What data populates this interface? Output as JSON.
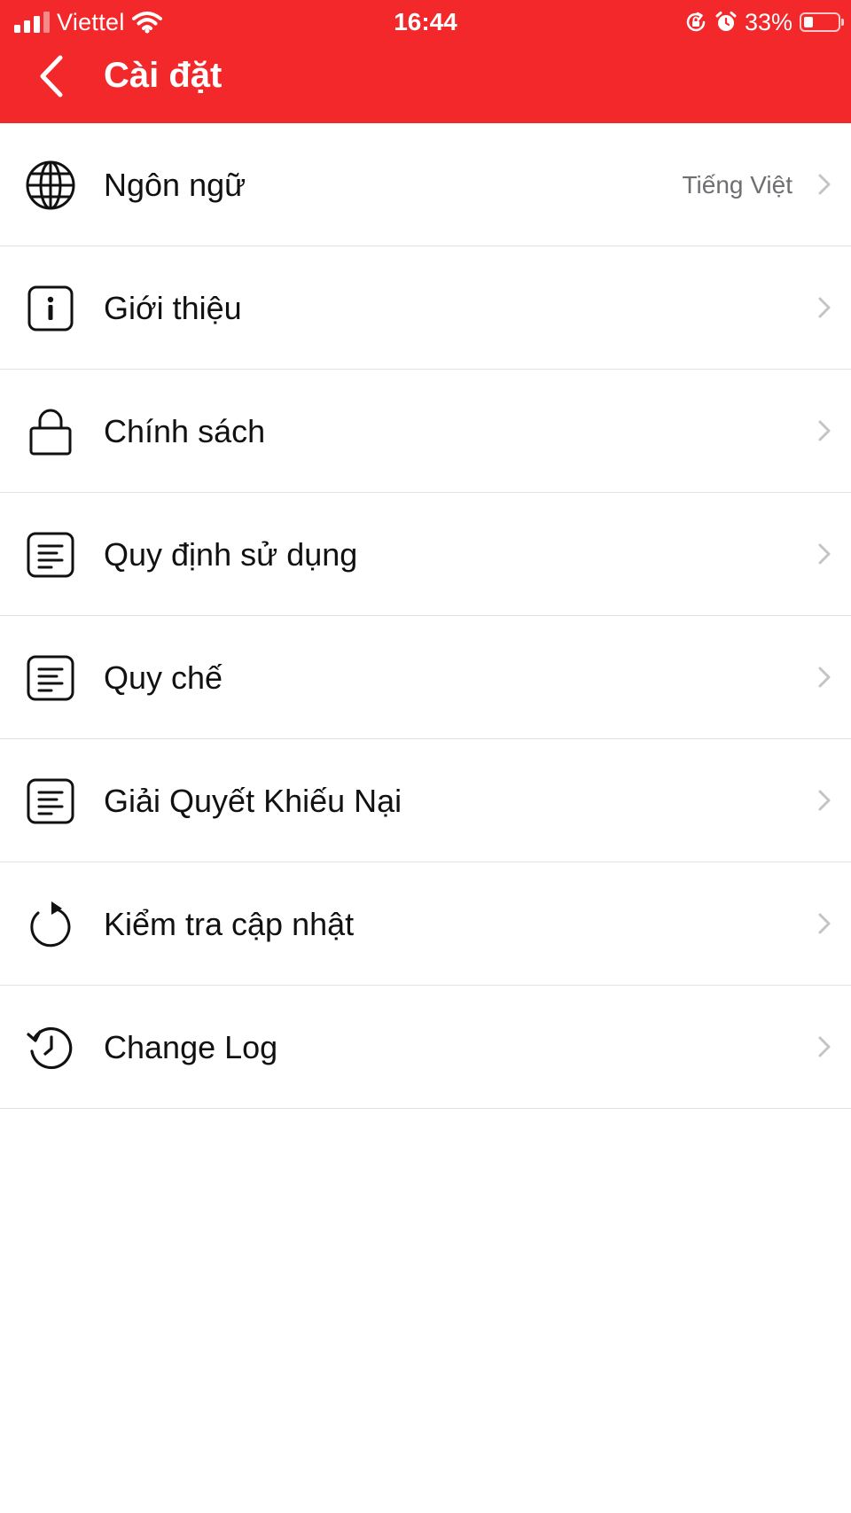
{
  "status_bar": {
    "carrier": "Viettel",
    "time": "16:44",
    "battery": "33%",
    "battery_level": 0.33,
    "icons": [
      "signal-icon",
      "wifi-icon",
      "orientation-lock-icon",
      "alarm-icon",
      "battery-icon"
    ]
  },
  "header": {
    "title": "Cài đặt",
    "back_icon": "chevron-left-icon",
    "background_color": "#f2282b"
  },
  "settings": [
    {
      "icon": "globe-icon",
      "label": "Ngôn ngữ",
      "value": "Tiếng Việt"
    },
    {
      "icon": "info-icon",
      "label": "Giới thiệu"
    },
    {
      "icon": "lock-icon",
      "label": "Chính sách"
    },
    {
      "icon": "document-icon",
      "label": "Quy định sử dụng"
    },
    {
      "icon": "document-icon",
      "label": "Quy chế"
    },
    {
      "icon": "document-icon",
      "label": "Giải Quyết Khiếu Nại"
    },
    {
      "icon": "refresh-icon",
      "label": "Kiểm tra cập nhật"
    },
    {
      "icon": "history-icon",
      "label": "Change Log"
    }
  ]
}
